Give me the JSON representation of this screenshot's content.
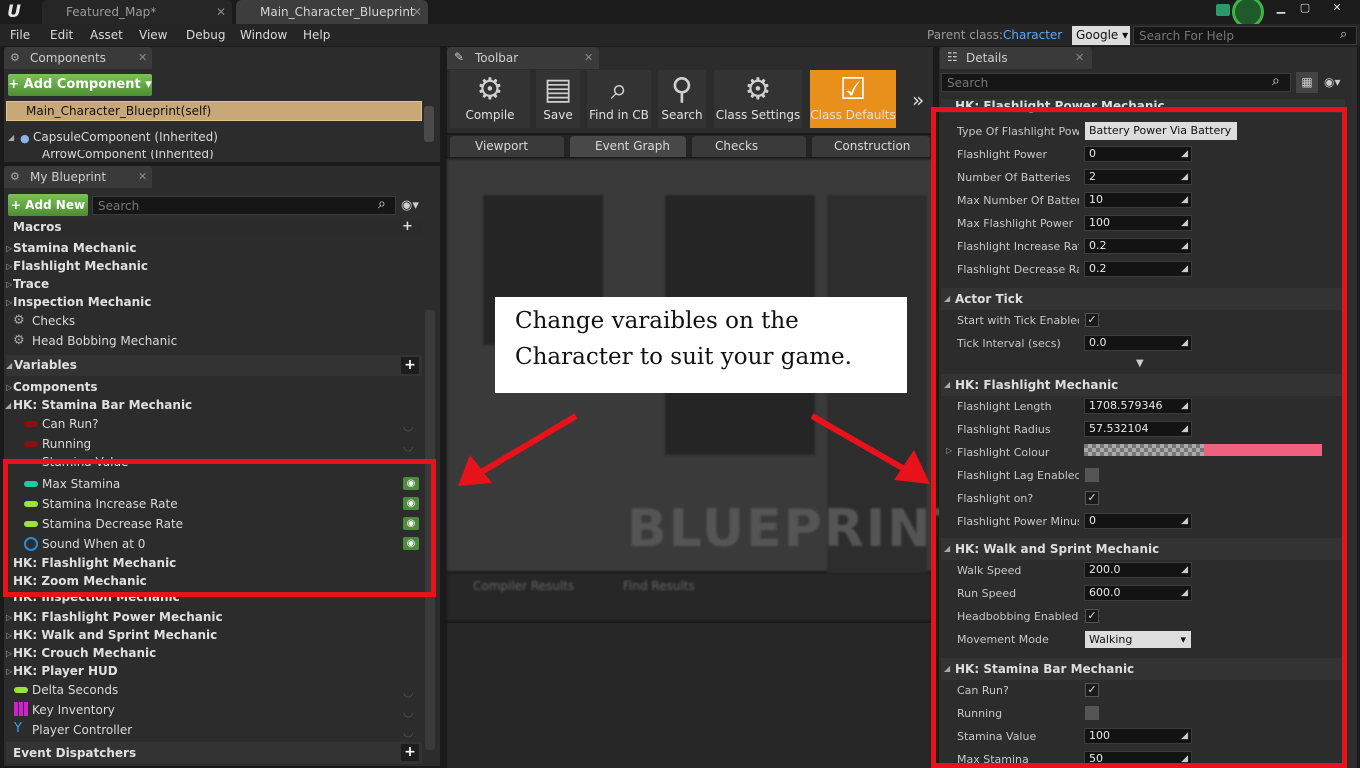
{
  "titlebar": {
    "tabs": [
      "Featured_Map*",
      "Main_Character_Blueprint"
    ],
    "close_glyph": "✕",
    "min_glyph": "▁",
    "max_glyph": "▢",
    "close_win_glyph": "✕"
  },
  "menu": {
    "items": [
      "File",
      "Edit",
      "Asset",
      "View",
      "Debug",
      "Window",
      "Help"
    ],
    "parent_label": "Parent class:",
    "parent_value": "Character",
    "search_provider": "Google",
    "help_placeholder": "Search For Help"
  },
  "components": {
    "title": "Components",
    "add_label": "+ Add Component ▾",
    "items": [
      "Main_Character_Blueprint(self)",
      "CapsuleComponent (Inherited)",
      "ArrowComponent (Inherited)"
    ]
  },
  "myblueprint": {
    "title": "My Blueprint",
    "add_label": "+ Add New ▾",
    "search_placeholder": "Search",
    "macros_header": "Macros",
    "macros": [
      "Stamina Mechanic",
      "Flashlight Mechanic",
      "Trace",
      "Inspection Mechanic"
    ],
    "macro_funcs": [
      "Checks",
      "Head Bobbing Mechanic"
    ],
    "variables_header": "Variables",
    "var_groups_top": [
      "Components",
      "HK: Stamina Bar Mechanic"
    ],
    "stamina_vars": [
      "Can Run?",
      "Running",
      "Stamina Value",
      "Max Stamina",
      "Stamina Increase Rate",
      "Stamina Decrease Rate",
      "Sound When at 0"
    ],
    "var_groups_bottom": [
      "HK: Flashlight Mechanic",
      "HK: Zoom Mechanic",
      "HK: Inspection Mechanic",
      "HK: Flashlight Power Mechanic",
      "HK: Walk and Sprint Mechanic",
      "HK: Crouch Mechanic",
      "HK: Player HUD"
    ],
    "misc_vars": [
      "Delta Seconds",
      "Key Inventory",
      "Player Controller"
    ],
    "dispatchers_header": "Event Dispatchers"
  },
  "toolbar": {
    "title": "Toolbar",
    "buttons": [
      "Compile",
      "Save",
      "Find in CB",
      "Search",
      "Class Settings",
      "Class Defaults"
    ],
    "more": "»"
  },
  "graph_tabs": [
    "Viewport",
    "Event Graph",
    "Checks",
    "Construction"
  ],
  "graph": {
    "watermark": "BLUEPRINT",
    "bottom_tabs": [
      "Compiler Results",
      "Find Results"
    ]
  },
  "callout": {
    "text": "Change varaibles on the Character to suit your game."
  },
  "details": {
    "title": "Details",
    "search_placeholder": "Search",
    "flash_power_header": "HK: Flashlight Power Mechanic",
    "flash_power": [
      [
        "Type Of Flashlight Powe",
        "Battery Power Via Battery"
      ],
      [
        "Flashlight Power",
        "0"
      ],
      [
        "Number Of Batteries",
        "2"
      ],
      [
        "Max Number Of Batteries",
        "10"
      ],
      [
        "Max Flashlight Power",
        "100"
      ],
      [
        "Flashlight Increase Rate",
        "0.2"
      ],
      [
        "Flashlight Decrease Rate",
        "0.2"
      ]
    ],
    "actor_tick_header": "Actor Tick",
    "actor_tick": [
      [
        "Start with Tick Enabled",
        "checked"
      ],
      [
        "Tick Interval (secs)",
        "0.0"
      ]
    ],
    "flashlight_header": "HK: Flashlight Mechanic",
    "flashlight": [
      [
        "Flashlight Length",
        "1708.579346"
      ],
      [
        "Flashlight Radius",
        "57.532104"
      ],
      [
        "Flashlight Colour",
        ""
      ],
      [
        "Flashlight Lag Enabled?",
        "unchecked"
      ],
      [
        "Flashlight on?",
        "checked"
      ],
      [
        "Flashlight Power Minus",
        "0"
      ]
    ],
    "walk_header": "HK: Walk and Sprint Mechanic",
    "walk": [
      [
        "Walk Speed",
        "200.0"
      ],
      [
        "Run Speed",
        "600.0"
      ],
      [
        "Headbobbing Enabled?",
        "checked"
      ],
      [
        "Movement Mode",
        "Walking"
      ]
    ],
    "stamina_header": "HK: Stamina Bar Mechanic",
    "stamina": [
      [
        "Can Run?",
        "checked"
      ],
      [
        "Running",
        "unchecked"
      ],
      [
        "Stamina Value",
        "100"
      ],
      [
        "Max Stamina",
        "50"
      ]
    ]
  },
  "colors": {
    "accent_orange": "#e8901a",
    "green": "#6ab04c",
    "red_annotation": "#e8121b",
    "flash_colour": "#f0607f"
  }
}
